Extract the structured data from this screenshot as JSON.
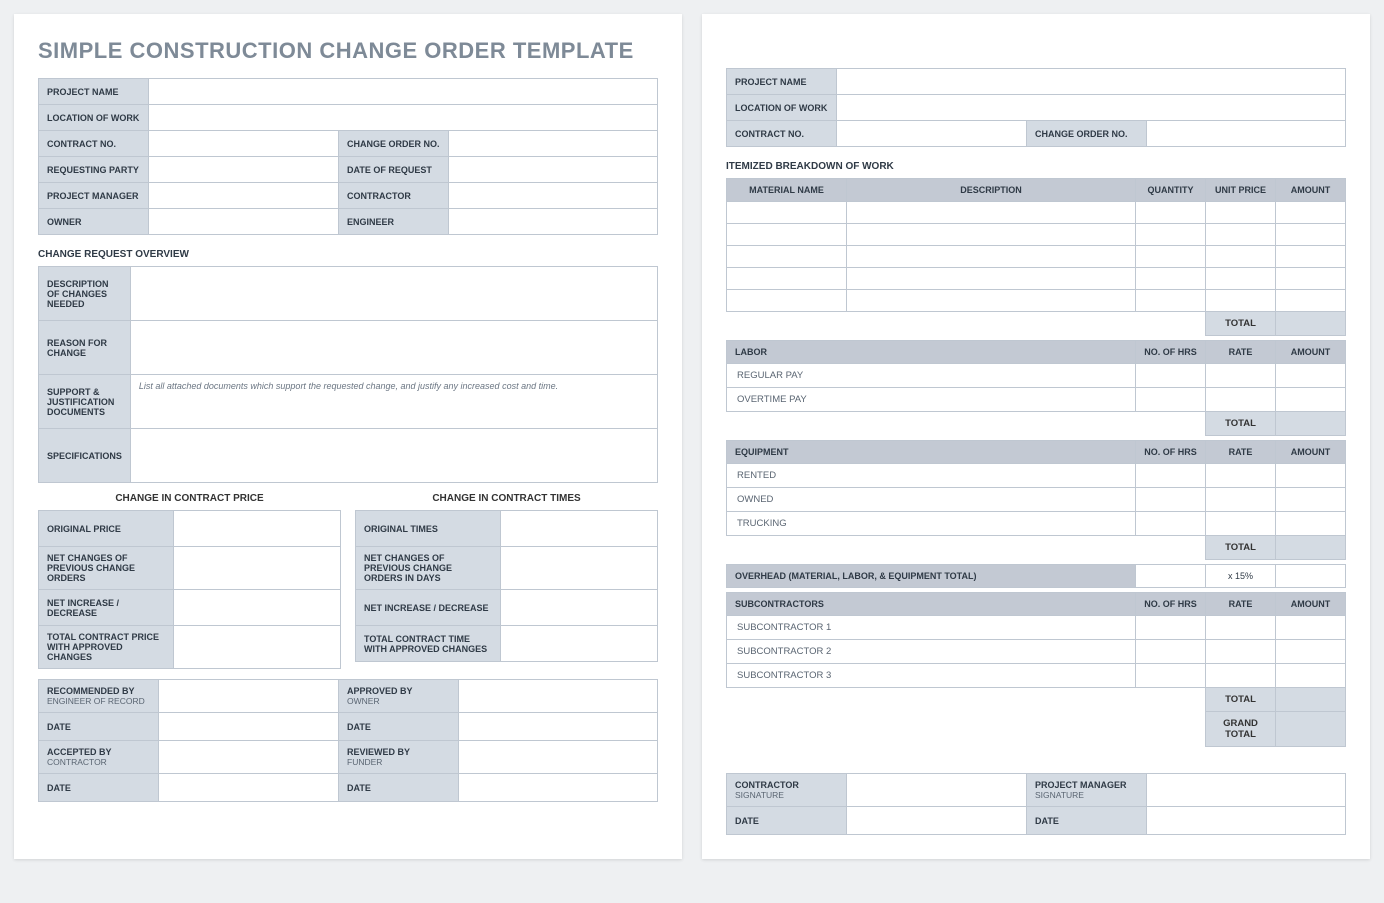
{
  "title": "SIMPLE CONSTRUCTION CHANGE ORDER TEMPLATE",
  "p1": {
    "info": {
      "project_name": "PROJECT NAME",
      "location": "LOCATION OF WORK",
      "contract_no": "CONTRACT NO.",
      "change_order_no": "CHANGE ORDER NO.",
      "requesting_party": "REQUESTING PARTY",
      "date_request": "DATE OF REQUEST",
      "pm": "PROJECT MANAGER",
      "contractor": "CONTRACTOR",
      "owner": "OWNER",
      "engineer": "ENGINEER"
    },
    "overview_title": "CHANGE REQUEST OVERVIEW",
    "overview": {
      "desc": "DESCRIPTION OF CHANGES NEEDED",
      "reason": "REASON FOR CHANGE",
      "support": "SUPPORT & JUSTIFICATION DOCUMENTS",
      "support_note": "List all attached documents which support the requested change, and justify any increased cost and time.",
      "specs": "SPECIFICATIONS"
    },
    "price": {
      "title": "CHANGE IN CONTRACT PRICE",
      "r1": "ORIGINAL PRICE",
      "r2": "NET CHANGES OF PREVIOUS CHANGE ORDERS",
      "r3": "NET INCREASE / DECREASE",
      "r4": "TOTAL CONTRACT PRICE WITH APPROVED CHANGES"
    },
    "times": {
      "title": "CHANGE IN CONTRACT TIMES",
      "r1": "ORIGINAL TIMES",
      "r2": "NET CHANGES OF PREVIOUS CHANGE ORDERS IN DAYS",
      "r3": "NET INCREASE / DECREASE",
      "r4": "TOTAL CONTRACT TIME WITH APPROVED CHANGES"
    },
    "sign": {
      "rec": "RECOMMENDED BY",
      "rec_sub": "ENGINEER OF RECORD",
      "app": "APPROVED BY",
      "app_sub": "OWNER",
      "acc": "ACCEPTED BY",
      "acc_sub": "CONTRACTOR",
      "rev": "REVIEWED BY",
      "rev_sub": "FUNDER",
      "date": "DATE"
    }
  },
  "p2": {
    "info": {
      "project_name": "PROJECT NAME",
      "location": "LOCATION OF WORK",
      "contract_no": "CONTRACT NO.",
      "change_order_no": "CHANGE ORDER NO."
    },
    "itm_title": "ITEMIZED BREAKDOWN OF WORK",
    "mat": {
      "c1": "MATERIAL NAME",
      "c2": "DESCRIPTION",
      "c3": "QUANTITY",
      "c4": "UNIT PRICE",
      "c5": "AMOUNT"
    },
    "labor": {
      "title": "LABOR",
      "c3": "NO. OF HRS",
      "c4": "RATE",
      "c5": "AMOUNT",
      "r1": "REGULAR PAY",
      "r2": "OVERTIME PAY"
    },
    "equip": {
      "title": "EQUIPMENT",
      "c3": "NO. OF HRS",
      "c4": "RATE",
      "c5": "AMOUNT",
      "r1": "RENTED",
      "r2": "OWNED",
      "r3": "TRUCKING"
    },
    "overhead": {
      "title": "OVERHEAD (MATERIAL, LABOR, & EQUIPMENT TOTAL)",
      "rate": "x 15%"
    },
    "subs": {
      "title": "SUBCONTRACTORS",
      "c3": "NO. OF HRS",
      "c4": "RATE",
      "c5": "AMOUNT",
      "r1": "SUBCONTRACTOR 1",
      "r2": "SUBCONTRACTOR 2",
      "r3": "SUBCONTRACTOR 3"
    },
    "total": "TOTAL",
    "grand_total": "GRAND TOTAL",
    "sign": {
      "con": "CONTRACTOR",
      "con_sub": "SIGNATURE",
      "pm": "PROJECT MANAGER",
      "pm_sub": "SIGNATURE",
      "date": "DATE"
    }
  }
}
